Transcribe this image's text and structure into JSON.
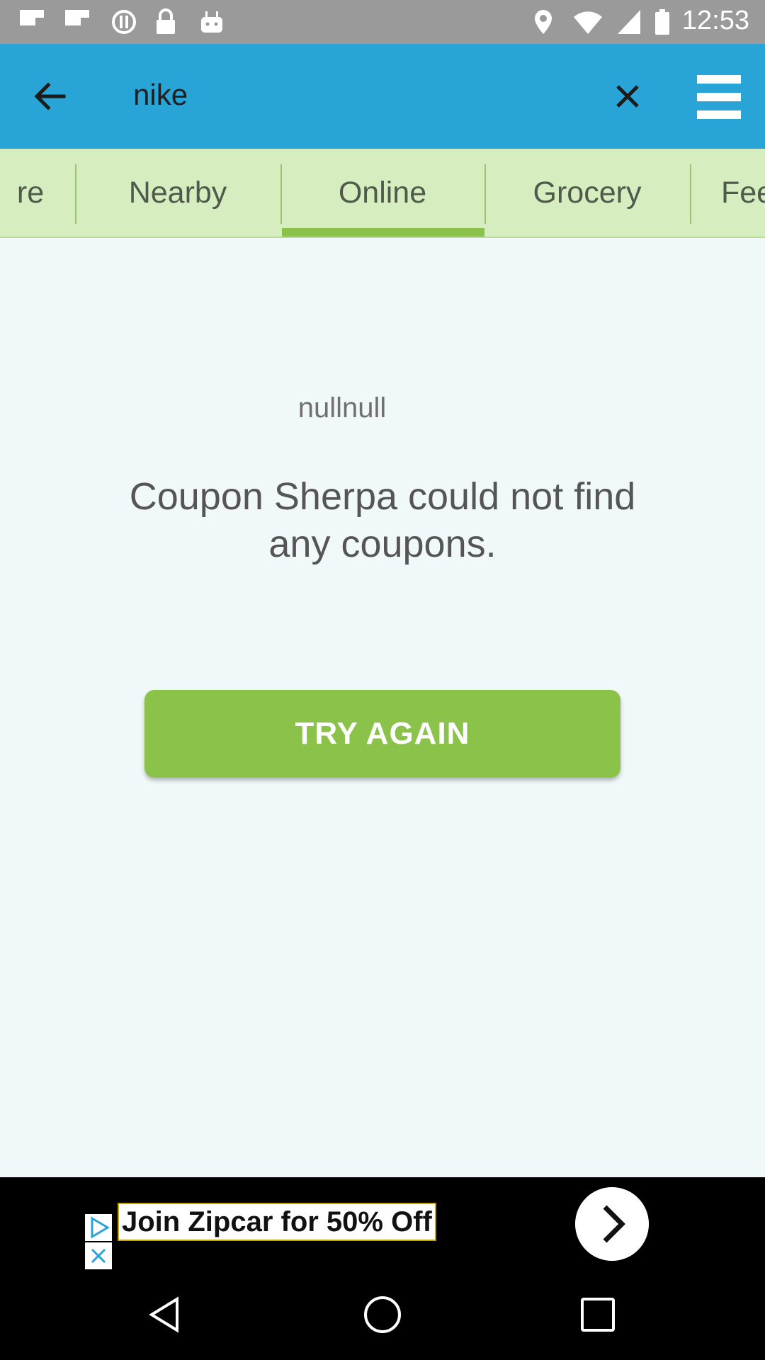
{
  "status_bar": {
    "time": "12:53"
  },
  "app_bar": {
    "query": "nike"
  },
  "tabs": [
    {
      "label": "re",
      "active": false
    },
    {
      "label": "Nearby",
      "active": false
    },
    {
      "label": "Online",
      "active": true
    },
    {
      "label": "Grocery",
      "active": false
    },
    {
      "label": "Fee",
      "active": false
    }
  ],
  "content": {
    "subtitle": "nullnull",
    "message": "Coupon Sherpa could not find any coupons.",
    "button_label": "TRY AGAIN"
  },
  "ad": {
    "text": "Join Zipcar for 50% Off"
  },
  "colors": {
    "app_bar": "#29a4d6",
    "accent_green": "#8bc34a",
    "tab_bar": "#d6edbf",
    "background": "#f1f8fa"
  }
}
